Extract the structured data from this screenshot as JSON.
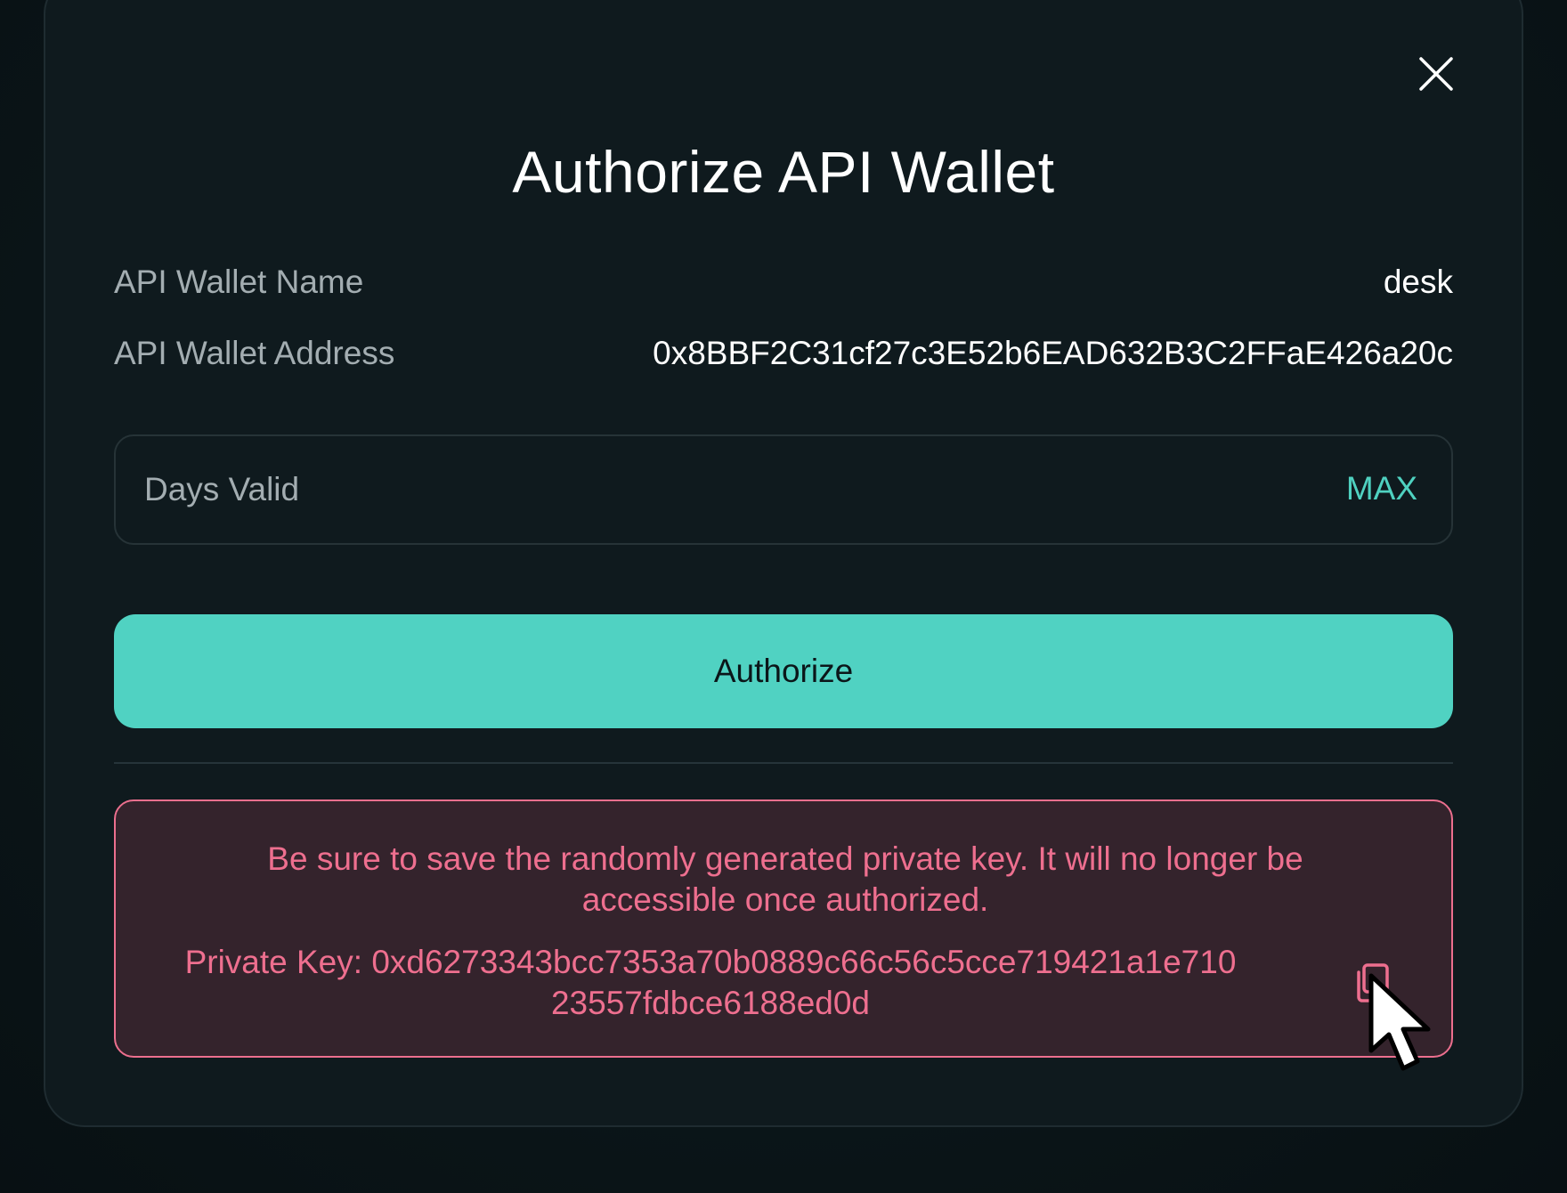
{
  "modal": {
    "title": "Authorize API Wallet",
    "close_icon": "close-icon"
  },
  "details": {
    "name_label": "API Wallet Name",
    "name_value": "desk",
    "address_label": "API Wallet Address",
    "address_value": "0x8BBF2C31cf27c3E52b6EAD632B3C2FFaE426a20c"
  },
  "days_input": {
    "placeholder": "Days Valid",
    "value": "",
    "max_label": "MAX"
  },
  "authorize_button": {
    "label": "Authorize"
  },
  "warning": {
    "message": "Be sure to save the randomly generated private key. It will no longer be accessible once authorized.",
    "private_key_label": "Private Key: 0xd6273343bcc7353a70b0889c66c56c5cce719421a1e710 23557fdbce6188ed0d",
    "copy_icon": "copy-icon"
  },
  "colors": {
    "accent": "#50d2c2",
    "warning": "#ee6f8f",
    "background": "#0f1a1e"
  },
  "mouse_cursor": "pointer-arrow-icon"
}
